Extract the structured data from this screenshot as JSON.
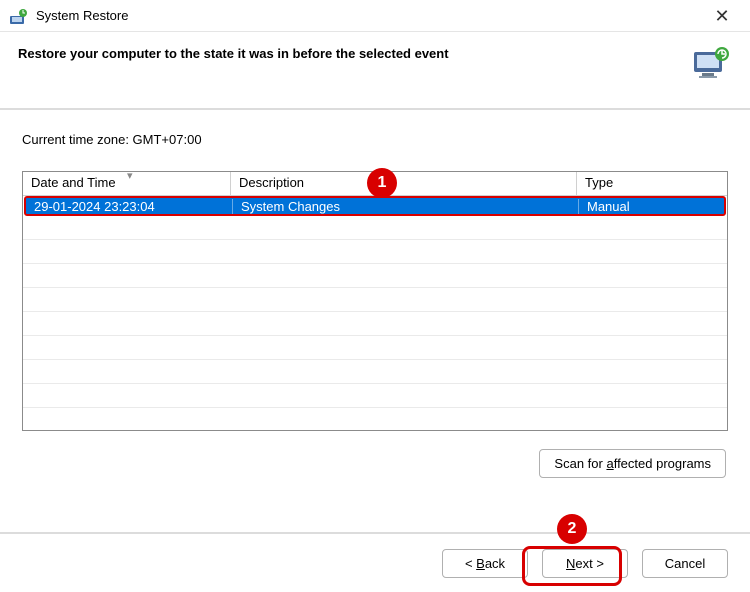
{
  "titlebar": {
    "title": "System Restore"
  },
  "header": {
    "heading": "Restore your computer to the state it was in before the selected event"
  },
  "content": {
    "timezone_label": "Current time zone: GMT+07:00",
    "columns": {
      "datetime": "Date and Time",
      "description": "Description",
      "type": "Type"
    },
    "rows": [
      {
        "datetime": "29-01-2024 23:23:04",
        "description": "System Changes",
        "type": "Manual"
      }
    ],
    "scan_button": "Scan for affected programs"
  },
  "footer": {
    "back": "< Back",
    "next": "Next >",
    "cancel": "Cancel"
  },
  "annotations": {
    "badge1": "1",
    "badge2": "2"
  }
}
